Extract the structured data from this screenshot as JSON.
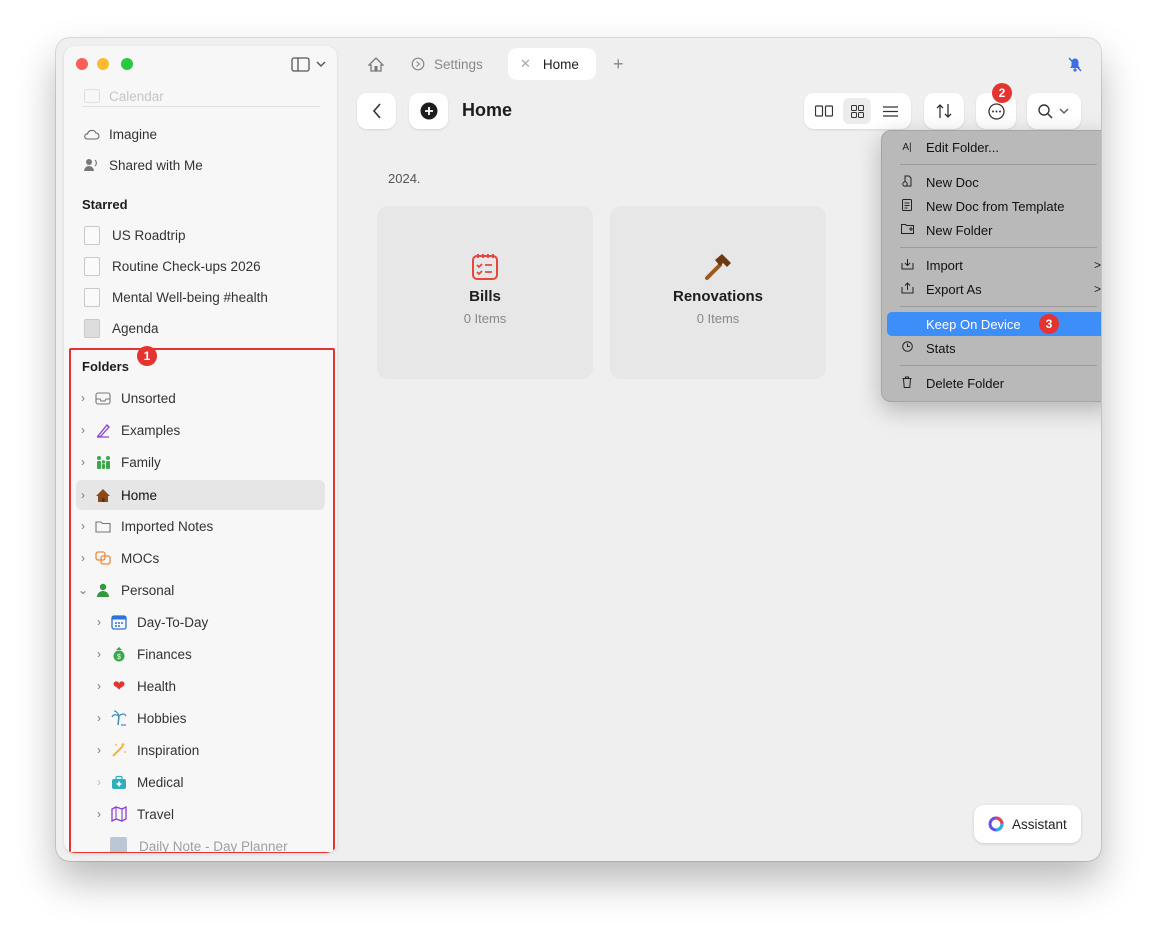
{
  "sidebar": {
    "top_partial": "Calendar",
    "items": [
      {
        "label": "Imagine",
        "icon": "cloud-icon"
      },
      {
        "label": "Shared with Me",
        "icon": "shared-people-icon"
      }
    ],
    "starred_header": "Starred",
    "starred": [
      {
        "label": "US Roadtrip"
      },
      {
        "label": "Routine Check-ups 2026"
      },
      {
        "label": "Mental Well-being #health"
      },
      {
        "label": "Agenda"
      }
    ],
    "folders_header": "Folders",
    "folders_badge": "1",
    "folders": [
      {
        "label": "Unsorted"
      },
      {
        "label": "Examples"
      },
      {
        "label": "Family"
      },
      {
        "label": "Home"
      },
      {
        "label": "Imported Notes"
      },
      {
        "label": "MOCs"
      },
      {
        "label": "Personal"
      }
    ],
    "subfolders": [
      {
        "label": "Day-To-Day"
      },
      {
        "label": "Finances"
      },
      {
        "label": "Health"
      },
      {
        "label": "Hobbies"
      },
      {
        "label": "Inspiration"
      },
      {
        "label": "Medical"
      },
      {
        "label": "Travel"
      }
    ],
    "bottom_partial": "Daily Note - Day Planner"
  },
  "tabs": {
    "settings": "Settings",
    "home": "Home"
  },
  "main": {
    "title": "Home",
    "more_badge": "2",
    "year_label": "2024.",
    "cards": [
      {
        "name": "Bills",
        "count": "0 Items"
      },
      {
        "name": "Renovations",
        "count": "0 Items"
      }
    ]
  },
  "menu": {
    "edit_folder": "Edit Folder...",
    "new_doc": "New Doc",
    "new_doc_template": "New Doc from Template",
    "new_folder": "New Folder",
    "import": "Import",
    "export_as": "Export As",
    "keep_on_device": "Keep On Device",
    "keep_badge": "3",
    "stats": "Stats",
    "delete_folder": "Delete Folder"
  },
  "assistant_label": "Assistant",
  "colors": {
    "accent": "#3d8ef8",
    "badge": "#e5342f",
    "highlight_box": "#e5342f"
  }
}
